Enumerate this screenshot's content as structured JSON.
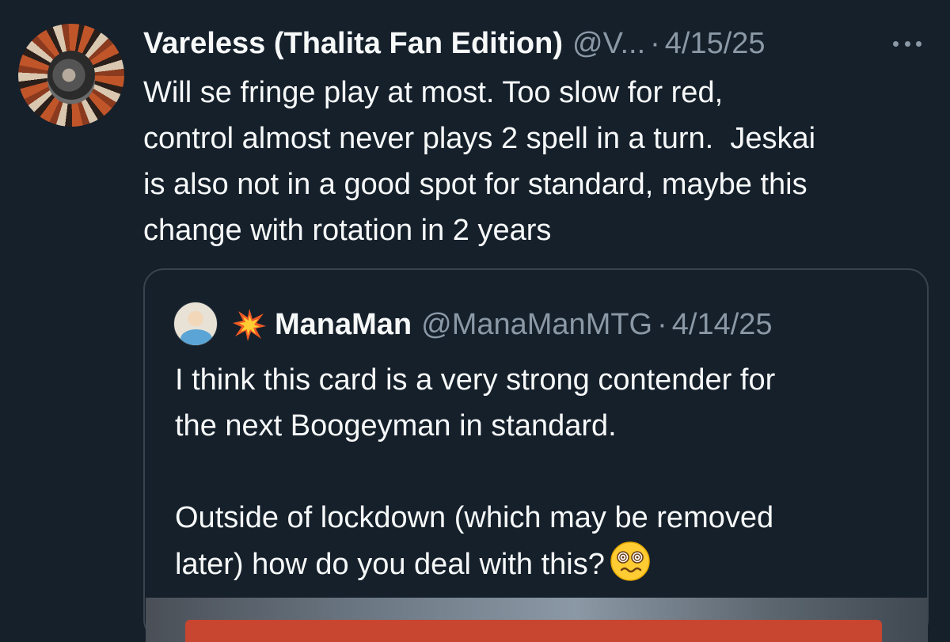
{
  "tweet": {
    "display_name": "Vareless (Thalita Fan Edition)",
    "handle": "@V...",
    "separator": "·",
    "date": "4/15/25",
    "more_icon": "more-horizontal-icon",
    "text": "Will se fringe play at most. Too slow for red,\ncontrol almost never plays 2 spell in a turn.  Jeskai\nis also not in a good spot for standard, maybe this\nchange with rotation in 2 years"
  },
  "quoted": {
    "emoji_icon": "collision-emoji-icon",
    "display_name": "ManaMan",
    "handle": "@ManaManMTG",
    "separator": "·",
    "date": "4/14/25",
    "text_1": "I think this card is a very strong contender for\nthe next Boogeyman in standard.\n\nOutside of lockdown (which may be removed\nlater) how do you deal with this?",
    "trailing_emoji_icon": "dizzy-face-emoji-icon"
  },
  "colors": {
    "background": "#15202b",
    "text_primary": "#f7f9f9",
    "text_secondary": "#8b98a5",
    "border": "#38444d"
  }
}
